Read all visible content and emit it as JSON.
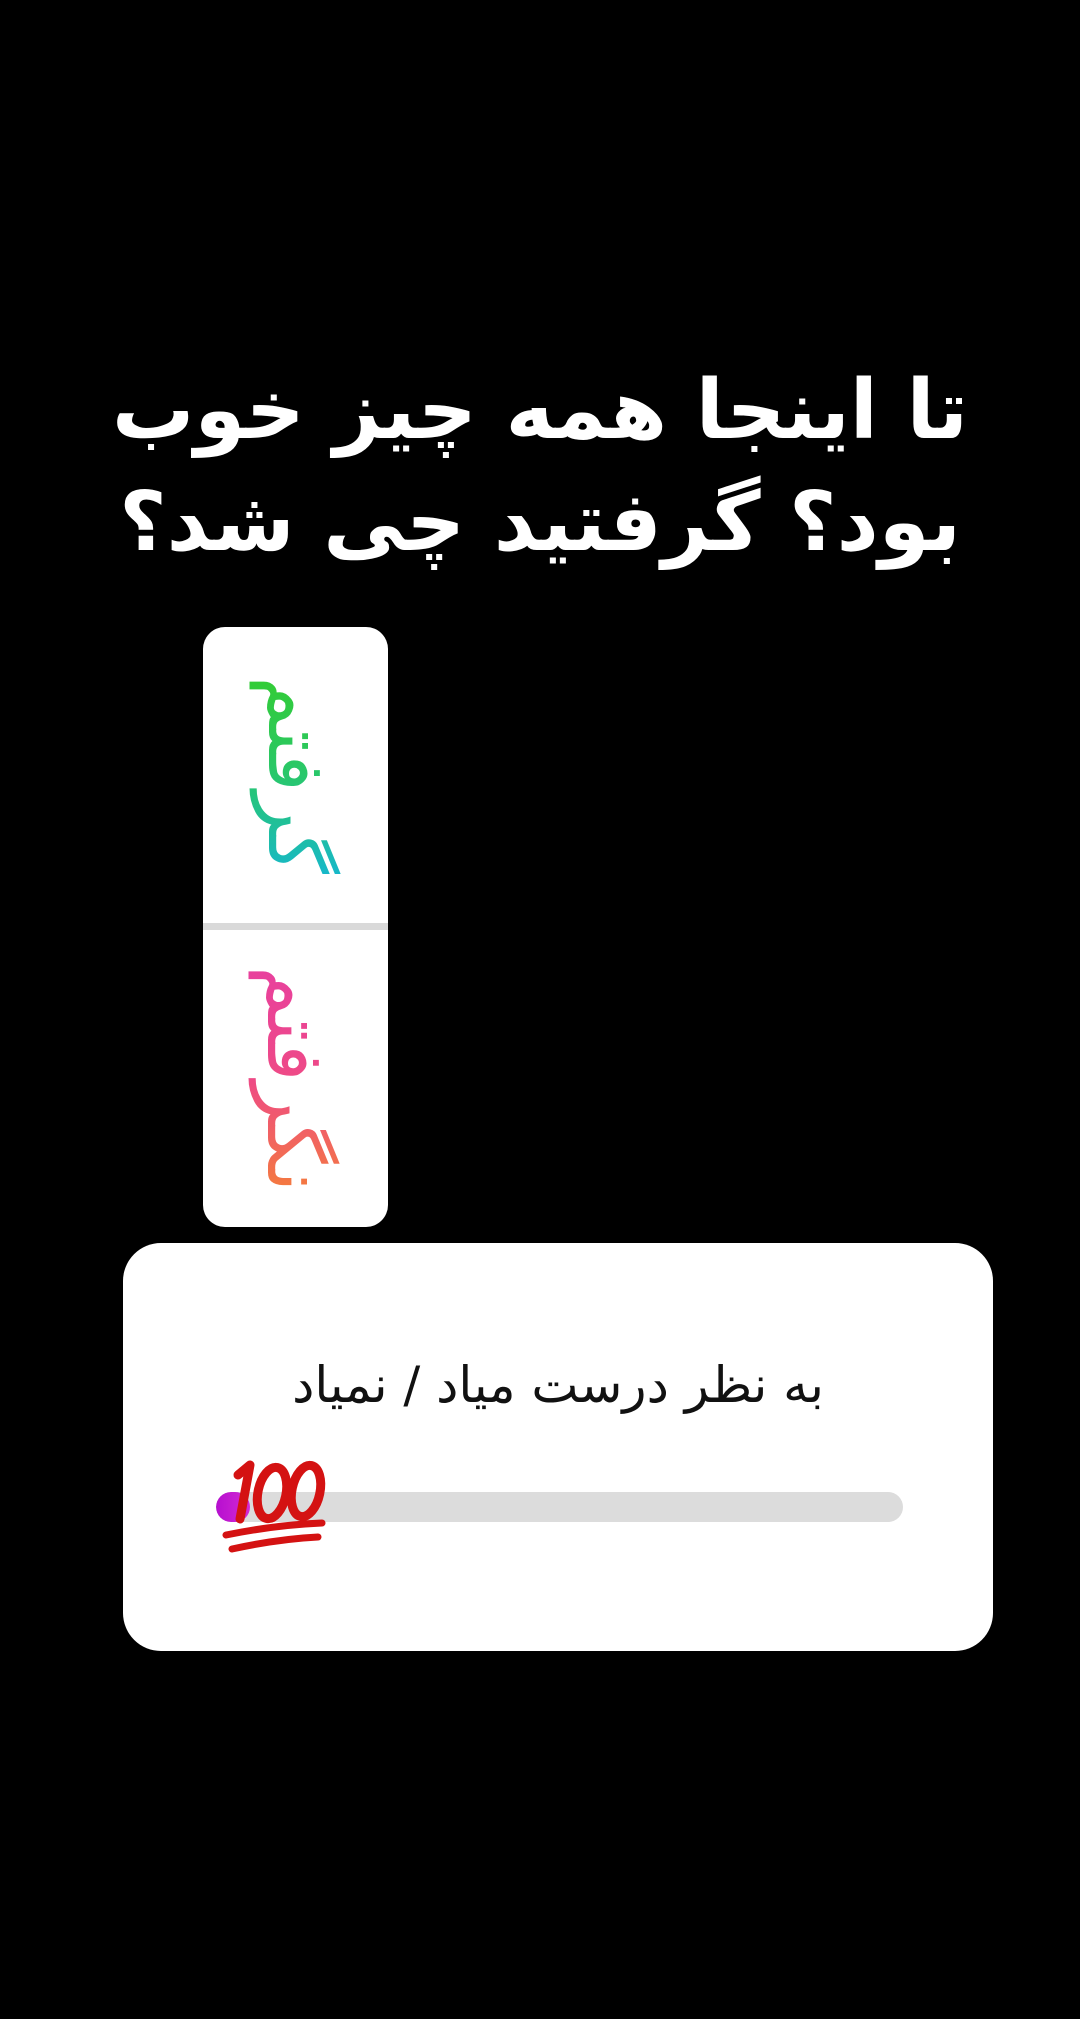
{
  "story": {
    "title": "تا اینجا همه چیز خوب بود؟ گرفتید چی شد؟"
  },
  "poll": {
    "options": [
      {
        "label": "گرفتم"
      },
      {
        "label": "نگرفتم"
      }
    ]
  },
  "slider": {
    "question": "به نظر درست میاد / نمیاد",
    "emoji": "hundred-points-emoji",
    "value_fraction": 0.05
  },
  "colors": {
    "background": "#000000",
    "card": "#ffffff",
    "track": "#dcdcdc",
    "slider_fill": "#b60fd0",
    "option_a_gradient": [
      "#17b8c8",
      "#33cc33"
    ],
    "option_b_gradient": [
      "#f47b3d",
      "#e8409e"
    ],
    "emoji_red": "#d41212"
  }
}
